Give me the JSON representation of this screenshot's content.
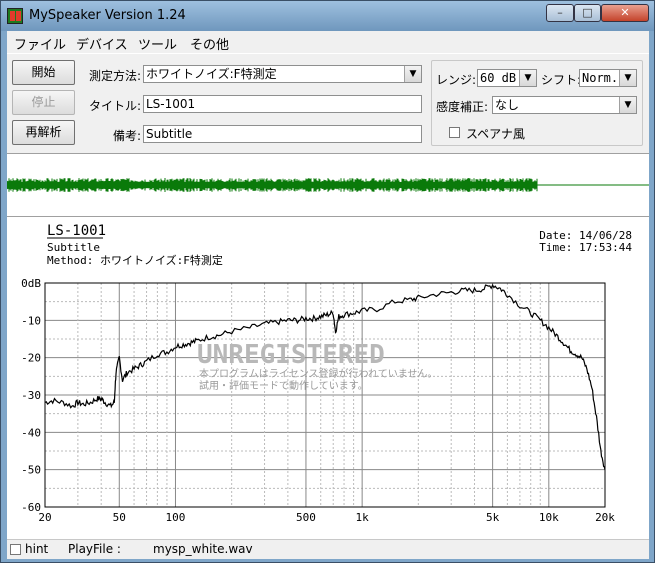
{
  "window": {
    "title": "MySpeaker Version 1.24",
    "minimize": "–",
    "maximize": "□",
    "close": "✕"
  },
  "menu": [
    "ファイル",
    "デバイス",
    "ツール",
    "その他"
  ],
  "buttons": {
    "start": "開始",
    "stop": "停止",
    "reanalyze": "再解析"
  },
  "form": {
    "method_label": "測定方法:",
    "method_value": "ホワイトノイズ:F特測定",
    "title_label": "タイトル:",
    "title_value": "LS-1001",
    "note_label": "備考:",
    "note_value": "Subtitle"
  },
  "options": {
    "range_label": "レンジ:",
    "range_value": "60 dB",
    "shift_label": "シフト:",
    "shift_value": "Norm.",
    "sensitivity_label": "感度補正:",
    "sensitivity_value": "なし",
    "spare_label": "スペアナ風",
    "spare_checked": false
  },
  "colors": {
    "waveform": "#0a7a0a",
    "plot_line": "#000000",
    "watermark": "#b8b8b8"
  },
  "graph": {
    "title": "LS-1001",
    "subtitle": "Subtitle",
    "method": "Method:  ホワイトノイズ:F特測定",
    "date": "Date: 14/06/28",
    "time": "Time: 17:53:44",
    "watermark": "UNREGISTERED",
    "notice_1": "本プログラムはライセンス登録が行われていません。",
    "notice_2": "試用・評価モードで動作しています。"
  },
  "status": {
    "hint_label": "hint",
    "playfile_label": "PlayFile  :",
    "playfile_value": "mysp_white.wav"
  },
  "chart_data": {
    "type": "line",
    "x_scale": "log",
    "xlim": [
      20,
      20000
    ],
    "ylim": [
      -60,
      0
    ],
    "x_ticks": [
      "20",
      "50",
      "100",
      "500",
      "1k",
      "5k",
      "10k",
      "20k"
    ],
    "y_ticks": [
      "0dB",
      "-10",
      "-20",
      "-30",
      "-40",
      "-50",
      "-60"
    ],
    "grid": true,
    "series": [
      {
        "x": [
          20,
          22,
          25,
          28,
          30,
          32,
          35,
          38,
          40,
          42,
          45,
          47,
          48,
          50,
          52,
          55,
          60,
          65,
          70,
          80,
          90,
          100,
          110,
          120,
          130,
          150,
          170,
          200,
          250,
          300,
          350,
          400,
          450,
          500,
          550,
          600,
          650,
          700,
          720,
          750,
          800,
          900,
          1000,
          1200,
          1500,
          1800,
          2000,
          2500,
          3000,
          3500,
          4000,
          4500,
          5000,
          5500,
          6000,
          7000,
          8000,
          9000,
          10000,
          11000,
          12000,
          13000,
          14000,
          15000,
          16000,
          17000,
          18000,
          19000,
          20000
        ],
        "y": [
          -32,
          -31.5,
          -32,
          -33,
          -32,
          -32.5,
          -32,
          -31,
          -31,
          -32,
          -33,
          -32,
          -24,
          -20,
          -26,
          -24,
          -23,
          -22,
          -21,
          -19,
          -18.5,
          -17,
          -16.5,
          -16,
          -15.5,
          -14.5,
          -14,
          -13,
          -12,
          -11,
          -10.5,
          -10,
          -10,
          -9.5,
          -9.5,
          -9,
          -8.5,
          -8,
          -13,
          -9,
          -8.5,
          -8,
          -7.5,
          -7,
          -5,
          -4.5,
          -4,
          -3,
          -2.5,
          -2,
          -2,
          -1.5,
          -0.5,
          -1.5,
          -3,
          -6,
          -8,
          -10,
          -12,
          -14,
          -16,
          -18,
          -19,
          -20,
          -23,
          -28,
          -36,
          -45,
          -50
        ]
      }
    ]
  }
}
